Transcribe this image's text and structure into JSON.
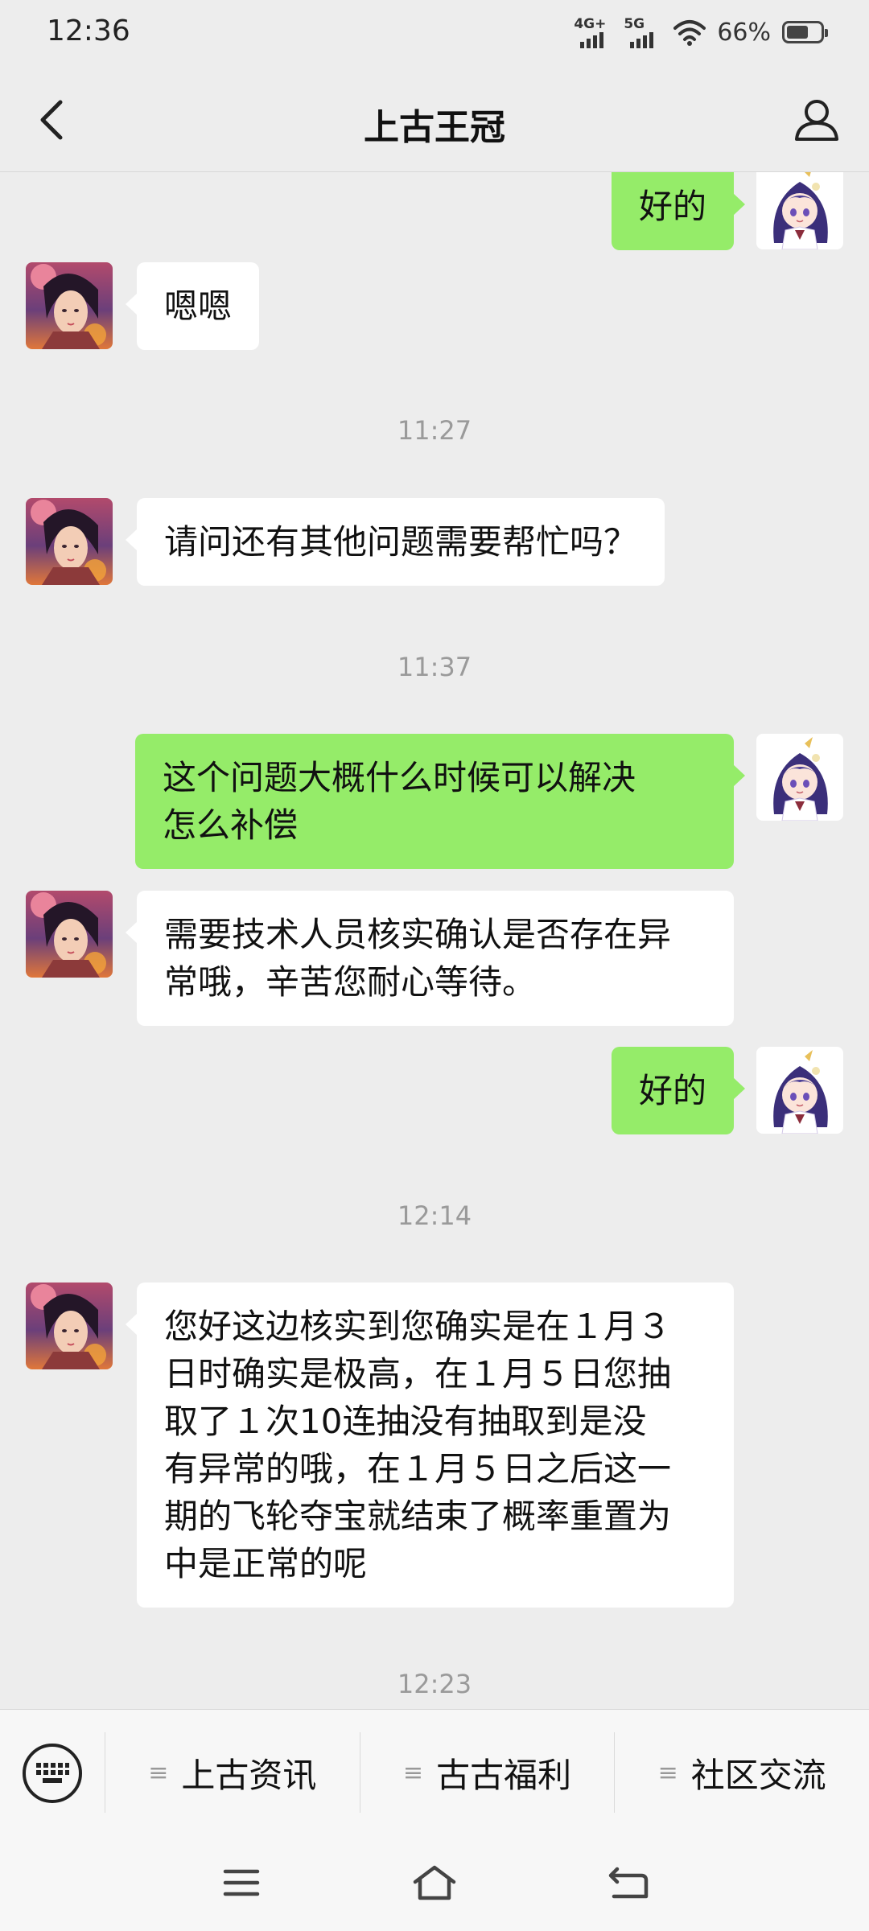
{
  "status_bar": {
    "time": "12:36",
    "network_1": "4G+",
    "network_2": "5G",
    "battery_percent": "66%",
    "battery_level": 0.66
  },
  "header": {
    "title": "上古王冠",
    "back_icon": "chevron-left-icon",
    "profile_icon": "person-icon"
  },
  "messages": [
    {
      "side": "out",
      "text": "好的"
    },
    {
      "side": "in",
      "text": "嗯嗯"
    },
    {
      "type": "time",
      "text": "11:27"
    },
    {
      "side": "in",
      "text": "请问还有其他问题需要帮忙吗？"
    },
    {
      "type": "time",
      "text": "11:37"
    },
    {
      "side": "out",
      "line1": "这个问题大概什么时候可以解决",
      "line2": "怎么补偿"
    },
    {
      "side": "in",
      "line1": "需要技术人员核实确认是否存在异",
      "line2": "常哦，辛苦您耐心等待。"
    },
    {
      "side": "out",
      "text": "好的"
    },
    {
      "type": "time",
      "text": "12:14"
    },
    {
      "side": "in",
      "lines": [
        "您好这边核实到您确实是在１月３",
        "日时确实是极高，在１月５日您抽",
        "取了１次10连抽没有抽取到是没",
        "有异常的哦，在１月５日之后这一",
        "期的飞轮夺宝就结束了概率重置为",
        "中是正常的呢"
      ]
    },
    {
      "type": "time",
      "text": "12:23"
    }
  ],
  "menu": {
    "keyboard_icon": "keyboard-icon",
    "items": [
      {
        "label": "上古资讯"
      },
      {
        "label": "古古福利"
      },
      {
        "label": "社区交流"
      }
    ]
  },
  "nav": {
    "menu_icon": "menu-icon",
    "home_icon": "home-icon",
    "back_icon": "return-icon"
  },
  "colors": {
    "background": "#ededed",
    "bubble_out": "#95ec69",
    "bubble_in": "#ffffff"
  }
}
